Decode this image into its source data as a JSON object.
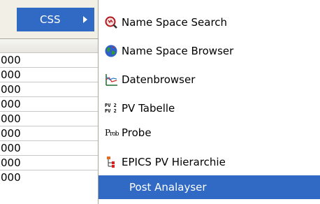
{
  "background_table": {
    "rows": [
      "000",
      "000",
      "000",
      "000",
      "000",
      "000",
      "000",
      "000",
      "000"
    ]
  },
  "parent_menu": {
    "css_label": "CSS"
  },
  "submenu": {
    "items": [
      {
        "label": "Name Space Search",
        "icon": "magnifier-search-icon"
      },
      {
        "label": "Name Space Browser",
        "icon": "globe-icon"
      },
      {
        "label": "Datenbrowser",
        "icon": "line-chart-icon"
      },
      {
        "label": "PV Tabelle",
        "icon": "pv-table-icon"
      },
      {
        "label": "Probe",
        "icon": "probe-icon"
      },
      {
        "label": "EPICS PV Hierarchie",
        "icon": "hierarchy-icon"
      },
      {
        "label": "Post Analayser",
        "icon": ""
      }
    ],
    "selected_index": 6
  },
  "colors": {
    "selection": "#316ac5",
    "menu_bg": "#ffffff",
    "parent_menu_bg": "#f1efe6"
  }
}
